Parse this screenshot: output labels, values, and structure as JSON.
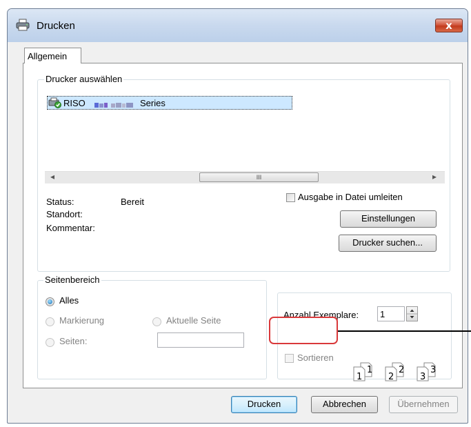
{
  "window": {
    "title": "Drucken",
    "close_glyph": "x"
  },
  "tabs": [
    {
      "label": "Allgemein"
    }
  ],
  "printer_group": {
    "legend": "Drucker auswählen",
    "printer_name_prefix": "RISO",
    "printer_name_suffix": "Series",
    "scroll_left": "◂",
    "scroll_right": "▸",
    "scroll_grip": "III"
  },
  "status_area": {
    "status_label": "Status:",
    "status_value": "Bereit",
    "location_label": "Standort:",
    "comment_label": "Kommentar:",
    "print_to_file_label": "Ausgabe in Datei umleiten",
    "print_to_file_checked": false,
    "settings_button": "Einstellungen",
    "find_printer_button": "Drucker suchen..."
  },
  "page_range": {
    "legend": "Seitenbereich",
    "all_label": "Alles",
    "selection_label": "Markierung",
    "current_page_label": "Aktuelle Seite",
    "pages_label": "Seiten:",
    "pages_value": "",
    "selected": "Alles"
  },
  "copies": {
    "count_label": "Anzahl Exemplare:",
    "count_value": "1",
    "collate_label": "Sortieren",
    "collate_checked": false,
    "collate_pages": [
      "1",
      "2",
      "3"
    ]
  },
  "footer": {
    "print_button": "Drucken",
    "cancel_button": "Abbrechen",
    "apply_button": "Übernehmen"
  },
  "colors": {
    "highlight_ring": "#d9383a",
    "callout_line": "#000000",
    "selection_bg": "#cde8ff"
  }
}
